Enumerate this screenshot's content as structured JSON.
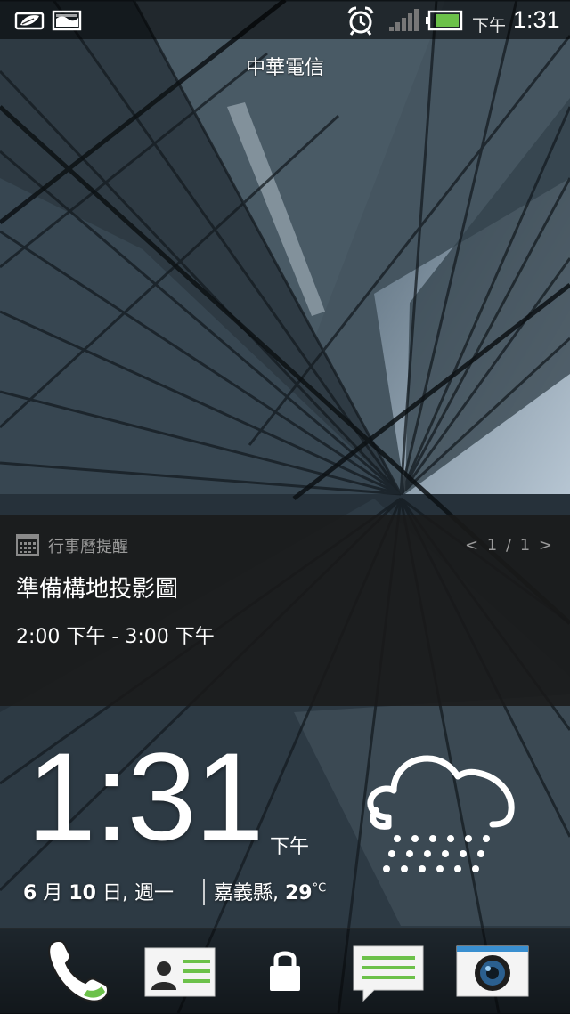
{
  "status_bar": {
    "time_suffix": "下午",
    "time": "1:31",
    "icons": [
      "leaf-notification-icon",
      "image-notification-icon",
      "alarm-icon",
      "signal-icon",
      "battery-icon"
    ]
  },
  "carrier": "中華電信",
  "notification": {
    "app": "行事曆提醒",
    "pager": "< 1 / 1 >",
    "title": "準備構地投影圖",
    "time": "2:00 下午 - 3:00 下午"
  },
  "clock": {
    "time": "1:31",
    "ampm": "下午"
  },
  "date": {
    "month_num": "6",
    "month_label": "月",
    "day_num": "10",
    "day_label": "日, 週一"
  },
  "weather": {
    "location": "嘉義縣,",
    "temp": "29",
    "unit": "°C",
    "icon": "rain-cloud-icon"
  },
  "dock": {
    "items": [
      "phone-icon",
      "contacts-icon",
      "lock-icon",
      "messages-icon",
      "camera-icon"
    ]
  },
  "colors": {
    "accent_green": "#6cc14a",
    "notification_bg": "#1a1a1a"
  }
}
